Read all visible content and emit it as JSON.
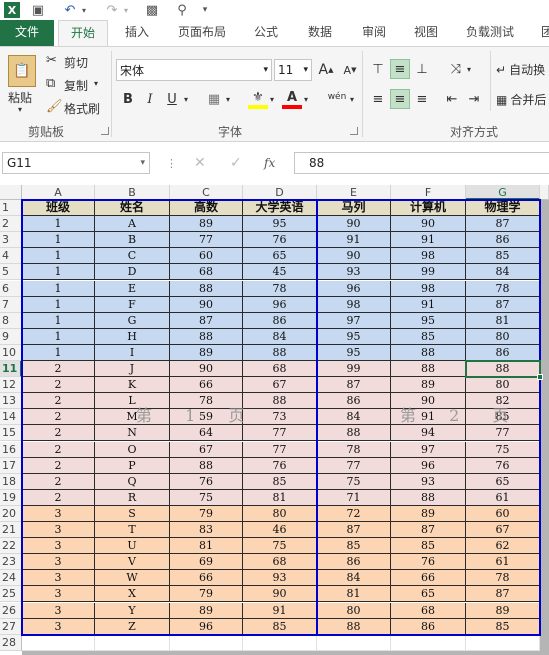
{
  "qat": {
    "icons": [
      "excel-logo-icon",
      "save-icon",
      "undo-icon",
      "redo-icon",
      "camera-icon",
      "print-preview-icon"
    ]
  },
  "tabs": [
    {
      "label": "文件",
      "name": "tab-file"
    },
    {
      "label": "开始",
      "name": "tab-home"
    },
    {
      "label": "插入",
      "name": "tab-insert"
    },
    {
      "label": "页面布局",
      "name": "tab-page-layout"
    },
    {
      "label": "公式",
      "name": "tab-formulas"
    },
    {
      "label": "数据",
      "name": "tab-data"
    },
    {
      "label": "审阅",
      "name": "tab-review"
    },
    {
      "label": "视图",
      "name": "tab-view"
    },
    {
      "label": "负载测试",
      "name": "tab-load-test"
    },
    {
      "label": "团",
      "name": "tab-team"
    }
  ],
  "ribbon": {
    "paste_label": "粘贴",
    "cut_label": "剪切",
    "copy_label": "复制",
    "format_painter_label": "格式刷",
    "clipboard_group": "剪贴板",
    "font_name": "宋体",
    "font_size": "11",
    "grow_font": "A",
    "shrink_font": "A",
    "bold": "B",
    "italic": "I",
    "underline": "U",
    "phonetic": "wén",
    "font_group": "字体",
    "wrap_text_label": "自动换",
    "merge_label": "合并后",
    "alignment_group": "对齐方式"
  },
  "formula_bar": {
    "name_box": "G11",
    "fx": "fx",
    "value": "88"
  },
  "columns": [
    "A",
    "B",
    "C",
    "D",
    "E",
    "F",
    "G"
  ],
  "selected_column": "G",
  "selected_row": 11,
  "headers": [
    "班级",
    "姓名",
    "高数",
    "大学英语",
    "马列",
    "计算机",
    "物理学"
  ],
  "rows": [
    [
      "1",
      "A",
      "89",
      "95",
      "90",
      "90",
      "87"
    ],
    [
      "1",
      "B",
      "77",
      "76",
      "91",
      "91",
      "86"
    ],
    [
      "1",
      "C",
      "60",
      "65",
      "90",
      "98",
      "85"
    ],
    [
      "1",
      "D",
      "68",
      "45",
      "93",
      "99",
      "84"
    ],
    [
      "1",
      "E",
      "88",
      "78",
      "96",
      "98",
      "78"
    ],
    [
      "1",
      "F",
      "90",
      "96",
      "98",
      "91",
      "87"
    ],
    [
      "1",
      "G",
      "87",
      "86",
      "97",
      "95",
      "81"
    ],
    [
      "1",
      "H",
      "88",
      "84",
      "95",
      "85",
      "80"
    ],
    [
      "1",
      "I",
      "89",
      "88",
      "95",
      "88",
      "86"
    ],
    [
      "2",
      "J",
      "90",
      "68",
      "99",
      "88",
      "88"
    ],
    [
      "2",
      "K",
      "66",
      "67",
      "87",
      "89",
      "80"
    ],
    [
      "2",
      "L",
      "78",
      "88",
      "86",
      "90",
      "82"
    ],
    [
      "2",
      "M",
      "59",
      "73",
      "84",
      "91",
      "85"
    ],
    [
      "2",
      "N",
      "64",
      "77",
      "88",
      "94",
      "77"
    ],
    [
      "2",
      "O",
      "67",
      "77",
      "78",
      "97",
      "75"
    ],
    [
      "2",
      "P",
      "88",
      "76",
      "77",
      "96",
      "76"
    ],
    [
      "2",
      "Q",
      "76",
      "85",
      "75",
      "93",
      "65"
    ],
    [
      "2",
      "R",
      "75",
      "81",
      "71",
      "88",
      "61"
    ],
    [
      "3",
      "S",
      "79",
      "80",
      "72",
      "89",
      "60"
    ],
    [
      "3",
      "T",
      "83",
      "46",
      "87",
      "87",
      "67"
    ],
    [
      "3",
      "U",
      "81",
      "75",
      "85",
      "85",
      "62"
    ],
    [
      "3",
      "V",
      "69",
      "68",
      "86",
      "76",
      "61"
    ],
    [
      "3",
      "W",
      "66",
      "93",
      "84",
      "66",
      "78"
    ],
    [
      "3",
      "X",
      "79",
      "90",
      "81",
      "65",
      "87"
    ],
    [
      "3",
      "Y",
      "89",
      "91",
      "80",
      "68",
      "89"
    ],
    [
      "3",
      "Z",
      "96",
      "85",
      "88",
      "86",
      "85"
    ]
  ],
  "row_numbers": [
    "1",
    "2",
    "3",
    "4",
    "5",
    "6",
    "7",
    "8",
    "9",
    "10",
    "11",
    "12",
    "13",
    "14",
    "15",
    "16",
    "17",
    "18",
    "19",
    "20",
    "21",
    "22",
    "23",
    "24",
    "25",
    "26",
    "27",
    "28"
  ],
  "watermarks": [
    "第 1 页",
    "第 2 页"
  ],
  "colors": {
    "class1": "#c6d9f1",
    "class2": "#f2dcdb",
    "class3": "#fcd5b4",
    "header": "#e4dfc4",
    "accent": "#217346",
    "print_border": "#0000cc"
  }
}
